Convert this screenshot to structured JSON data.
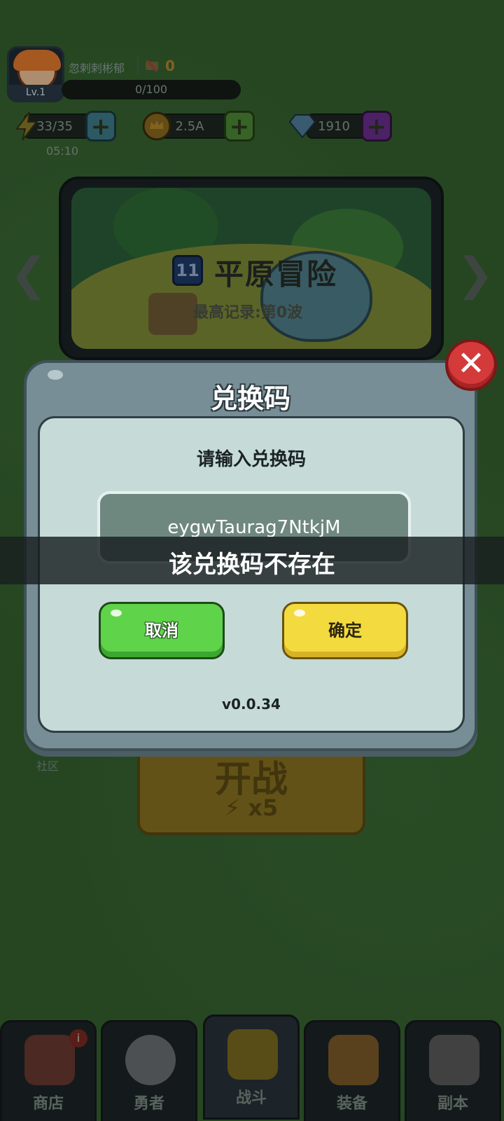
{
  "player": {
    "name": "忽剌剌彬郁",
    "level": "Lv.1",
    "trophies": "0",
    "xp": "0/100"
  },
  "resources": {
    "energy": "33/35",
    "energy_timer": "05:10",
    "gold": "2.5A",
    "gems": "1910",
    "plus": "+"
  },
  "stage": {
    "number": "11",
    "title": "平原冒险",
    "record": "最高记录:第0波",
    "prev": "❮",
    "next": "❯"
  },
  "battle": {
    "label": "开战",
    "cost": "⚡ x5"
  },
  "community": "社区",
  "nav": {
    "items": [
      {
        "label": "商店",
        "badge": "i"
      },
      {
        "label": "勇者"
      },
      {
        "label": "战斗"
      },
      {
        "label": "装备"
      },
      {
        "label": "副本"
      }
    ]
  },
  "modal": {
    "title": "兑换码",
    "prompt": "请输入兑换码",
    "code_value": "eygwTaurag7NtkjM",
    "cancel_label": "取消",
    "confirm_label": "确定",
    "version": "v0.0.34",
    "close": "✕"
  },
  "toast": {
    "message": "该兑换码不存在"
  },
  "colors": {
    "cancel": "#5fd34a",
    "confirm": "#f3db3f",
    "close": "#d43a3a"
  }
}
